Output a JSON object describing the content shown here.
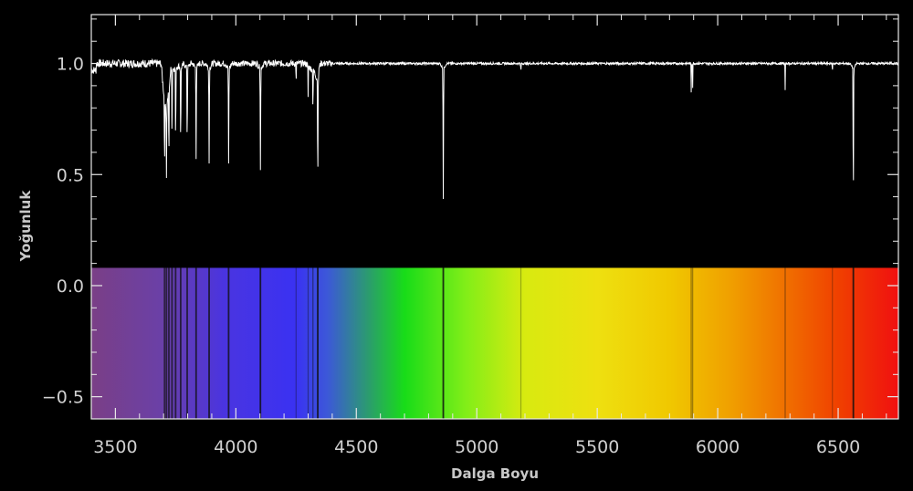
{
  "chart_data": {
    "type": "line",
    "xlabel": "Dalga Boyu",
    "ylabel": "Yoğunluk",
    "xlim": [
      3400,
      6750
    ],
    "ylim": [
      -0.6,
      1.22
    ],
    "x_ticks": [
      3500,
      4000,
      4500,
      5000,
      5500,
      6000,
      6500
    ],
    "x_tick_labels": [
      "3500",
      "4000",
      "4500",
      "5000",
      "5500",
      "6000",
      "6500"
    ],
    "y_ticks": [
      1.0,
      0.5,
      0.0,
      -0.5
    ],
    "y_tick_labels": [
      "1.0",
      "0.5",
      "0.0",
      "−0.5"
    ],
    "series": [
      {
        "continuum": 1.0,
        "absorption_lines": [
          {
            "x": 3704,
            "y": 0.65
          },
          {
            "x": 3712,
            "y": 0.64
          },
          {
            "x": 3722,
            "y": 0.63
          },
          {
            "x": 3735,
            "y": 0.62
          },
          {
            "x": 3750,
            "y": 0.61
          },
          {
            "x": 3771,
            "y": 0.6
          },
          {
            "x": 3798,
            "y": 0.6
          },
          {
            "x": 3835,
            "y": 0.57
          },
          {
            "x": 3889,
            "y": 0.55
          },
          {
            "x": 3970,
            "y": 0.55
          },
          {
            "x": 4102,
            "y": 0.52
          },
          {
            "x": 4250,
            "y": 0.9
          },
          {
            "x": 4300,
            "y": 0.86
          },
          {
            "x": 4320,
            "y": 0.78
          },
          {
            "x": 4340,
            "y": 0.47
          },
          {
            "x": 4861,
            "y": 0.39
          },
          {
            "x": 5183,
            "y": 0.96
          },
          {
            "x": 5890,
            "y": 0.87
          },
          {
            "x": 5896,
            "y": 0.89
          },
          {
            "x": 6280,
            "y": 0.88
          },
          {
            "x": 6476,
            "y": 0.96
          },
          {
            "x": 6563,
            "y": 0.32
          }
        ]
      }
    ],
    "spectrum_band": {
      "y_range": [
        -0.6,
        0.08
      ],
      "colors": [
        "#7a3f86",
        "#6a40a8",
        "#4a34e0",
        "#3a32f2",
        "#3c58d8",
        "#2aa068",
        "#18dc18",
        "#80ee18",
        "#d8ea10",
        "#eee010",
        "#f0c800",
        "#f0a000",
        "#f07000",
        "#f04000",
        "#f01010"
      ],
      "color_positions": [
        3400,
        3700,
        3950,
        4250,
        4380,
        4560,
        4700,
        4950,
        5200,
        5500,
        5800,
        6050,
        6280,
        6500,
        6750
      ]
    }
  }
}
